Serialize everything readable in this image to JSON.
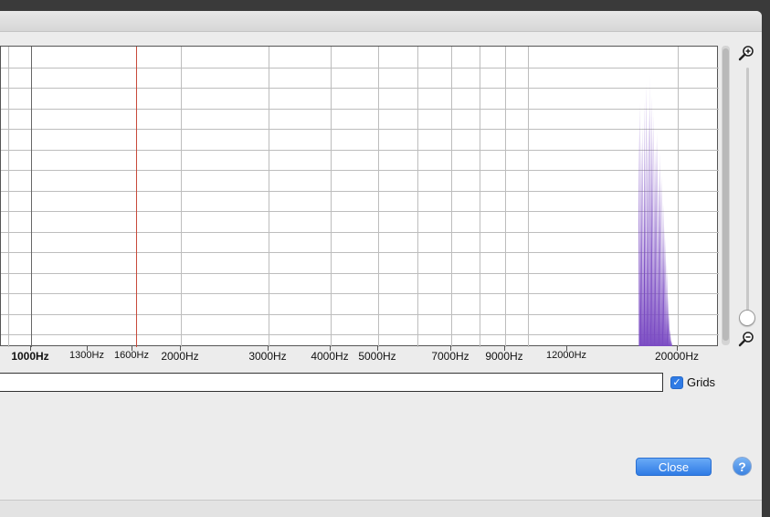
{
  "window": {
    "title": ""
  },
  "chart_data": {
    "type": "area",
    "x_scale": "log",
    "grid": true,
    "xlabel": "",
    "ylabel": "",
    "cursor_hz": 1630,
    "tick_labels": [
      "1000Hz",
      "1300Hz",
      "1600Hz",
      "2000Hz",
      "3000Hz",
      "4000Hz",
      "5000Hz",
      "7000Hz",
      "9000Hz",
      "12000Hz",
      "20000Hz"
    ],
    "tick_values": [
      1000,
      1300,
      1600,
      2000,
      3000,
      4000,
      5000,
      7000,
      9000,
      12000,
      20000
    ],
    "series_color": "#7b4cc3",
    "spectrum_level": [
      0.0,
      0.0,
      0.0,
      0.75,
      0.85,
      0.72,
      0.78,
      0.86,
      0.7,
      0.92,
      0.8,
      0.84,
      0.95,
      0.85,
      0.88,
      0.75,
      0.82,
      0.7,
      0.72,
      0.75,
      0.62,
      0.68,
      0.58,
      0.6,
      0.5,
      0.42,
      0.38,
      0.3,
      0.18,
      0.12,
      0.06,
      0.02,
      0.0
    ],
    "spectrum_hz": [
      16500,
      16600,
      16650,
      16700,
      16800,
      16900,
      17000,
      17100,
      17200,
      17300,
      17400,
      17500,
      17550,
      17600,
      17700,
      17800,
      17900,
      18000,
      18100,
      18200,
      18300,
      18400,
      18500,
      18600,
      18700,
      18800,
      18900,
      19000,
      19100,
      19200,
      19300,
      19400,
      19500
    ]
  },
  "options": {
    "grids_label": "Grids",
    "grids_checked": true
  },
  "buttons": {
    "close_label": "Close",
    "help_label": "?"
  },
  "colors": {
    "accent": "#2f7be5",
    "spectrum": "#7b4cc3",
    "cursor_line": "#c84a3a"
  }
}
